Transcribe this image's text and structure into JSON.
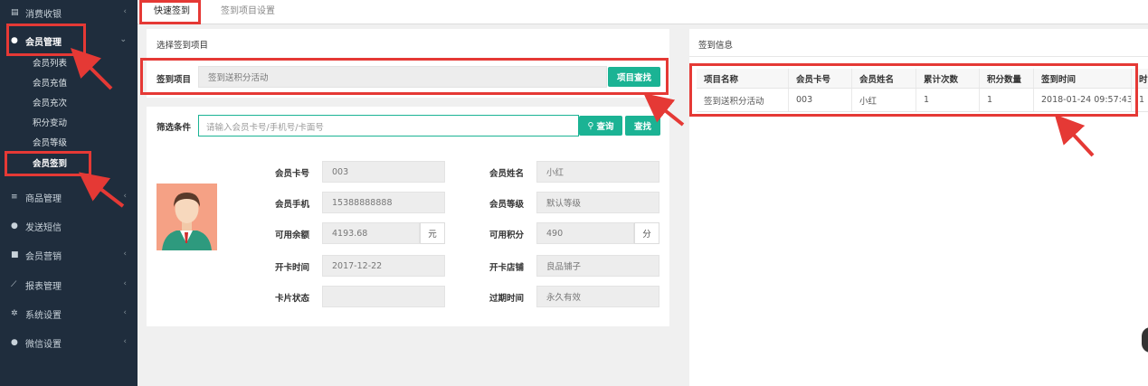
{
  "sidebar": {
    "items": [
      {
        "label": "消费收银",
        "icon": "receipt-icon"
      },
      {
        "label": "会员管理",
        "icon": "user-icon"
      },
      {
        "label": "商品管理",
        "icon": "database-icon"
      },
      {
        "label": "发送短信",
        "icon": "chat-icon"
      },
      {
        "label": "会员营销",
        "icon": "briefcase-icon"
      },
      {
        "label": "报表管理",
        "icon": "line-chart-icon"
      },
      {
        "label": "系统设置",
        "icon": "gears-icon"
      },
      {
        "label": "微信设置",
        "icon": "wechat-icon"
      }
    ],
    "subitems": [
      "会员列表",
      "会员充值",
      "会员充次",
      "积分变动",
      "会员等级",
      "会员签到"
    ]
  },
  "tabs": [
    "快速签到",
    "签到项目设置"
  ],
  "left": {
    "section_title": "选择签到项目",
    "project_label": "签到项目",
    "project_value": "签到送积分活动",
    "project_button": "项目查找",
    "filter_label": "筛选条件",
    "filter_placeholder": "请输入会员卡号/手机号/卡面号",
    "query_button": "查询",
    "find_button": "查找"
  },
  "member": {
    "card_no_label": "会员卡号",
    "card_no": "003",
    "name_label": "会员姓名",
    "name": "小红",
    "phone_label": "会员手机",
    "phone": "15388888888",
    "level_label": "会员等级",
    "level": "默认等级",
    "balance_label": "可用余额",
    "balance": "4193.68",
    "balance_unit": "元",
    "points_label": "可用积分",
    "points": "490",
    "points_unit": "分",
    "open_time_label": "开卡时间",
    "open_time": "2017-12-22",
    "open_store_label": "开卡店铺",
    "open_store": "良品铺子",
    "status_label": "卡片状态",
    "status": "",
    "expire_label": "过期时间",
    "expire": "永久有效"
  },
  "right": {
    "section_title": "签到信息",
    "columns": [
      "项目名称",
      "会员卡号",
      "会员姓名",
      "累计次数",
      "积分数量",
      "签到时间",
      "时"
    ],
    "rows": [
      [
        "签到送积分活动",
        "003",
        "小红",
        "1",
        "1",
        "2018-01-24 09:57:43",
        "1"
      ]
    ]
  },
  "colors": {
    "sidebar": "#1f2d3d",
    "accent": "#1bb394",
    "highlight": "#e53935"
  }
}
